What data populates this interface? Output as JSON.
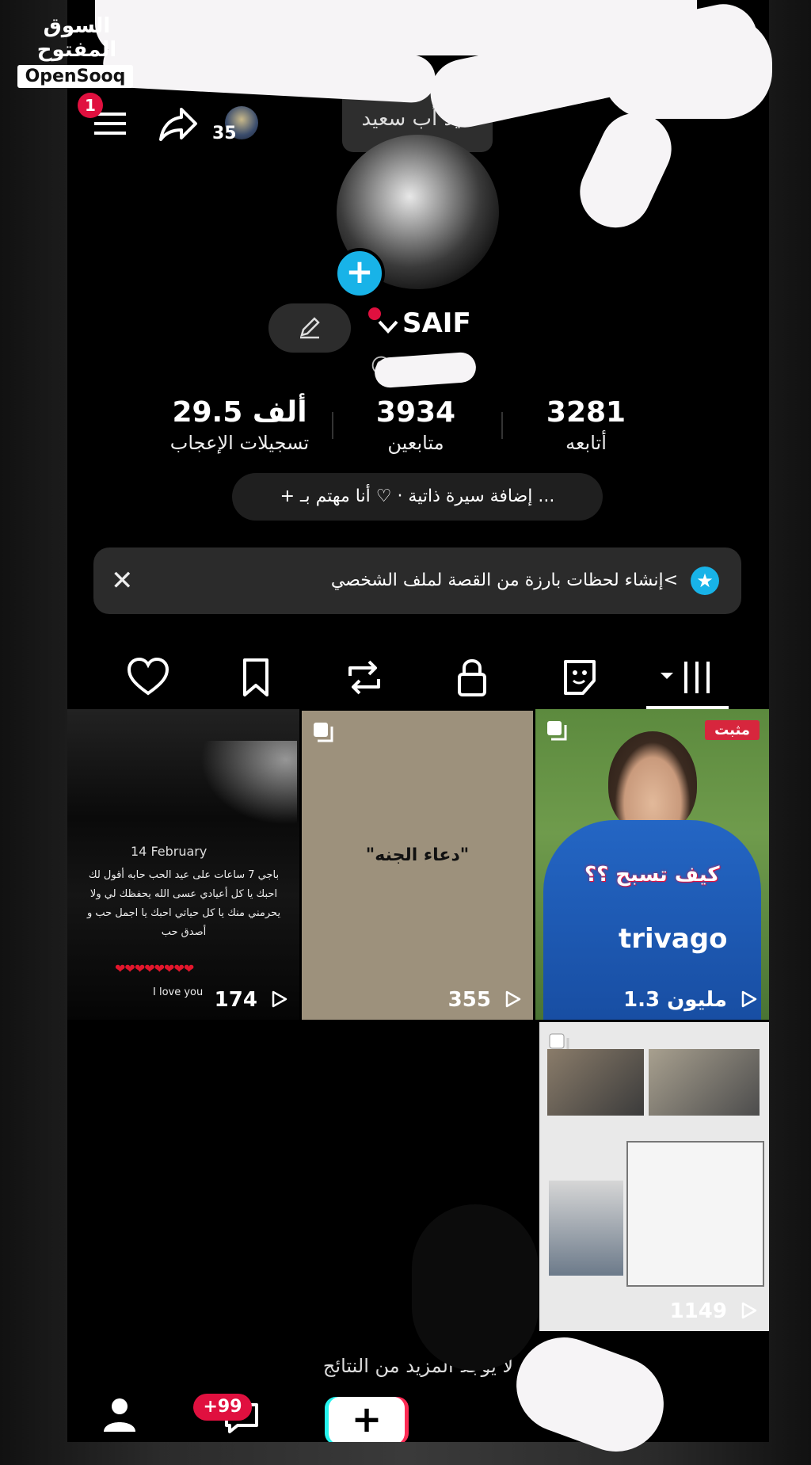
{
  "watermark": {
    "arabic": "السوق المفتوح",
    "english": "OpenSooq"
  },
  "topbar": {
    "menu_badge": "1",
    "friends_count": "35"
  },
  "tooltip": "عيد أب سعيد",
  "profile": {
    "username": "SAIF",
    "handle": "@yo..."
  },
  "stats": [
    {
      "value": "3281",
      "label": "أتابعه"
    },
    {
      "value": "3934",
      "label": "متابعين"
    },
    {
      "value": "29.5 ألف",
      "label": "تسجيلات الإعجاب"
    }
  ],
  "bio_button": "+ إضافة سيرة ذاتية · ♡ أنا مهتم بـ ...",
  "highlight_banner": "إنشاء لحظات بارزة من القصة لملف الشخصي<",
  "tabs": [
    "videos-tab",
    "collections-tab",
    "favorites-tab",
    "reposts-tab",
    "liked-tab",
    "private-tab"
  ],
  "posts": [
    {
      "pinned_label": "مثبت",
      "caption": "كيف تسبح ؟؟",
      "jersey": "trivago",
      "views": "1.3 مليون"
    },
    {
      "title": "\"دعاء الجنه\"",
      "views": "355"
    },
    {
      "date": "14 February",
      "caption": "باجي 7 ساعات على عيد الحب حابه أقول لك احبك يا كل أعيادي عسى الله يحفظك لي ولا يحرمني منك يا كل حياتي احبك يا اجمل حب و أصدق حب",
      "hearts": "❤❤❤❤❤❤❤❤",
      "footer": "I love you",
      "views": "174"
    },
    {
      "views": "1149"
    }
  ],
  "no_more_text": "لا يوجد المزيد من النتائج",
  "bottom_nav": {
    "inbox_badge": "+99"
  },
  "colors": {
    "accent_blue": "#18b3e8",
    "badge_red": "#e0103f",
    "pinned_red": "#d7263d",
    "doc_bg": "#9d917c"
  }
}
